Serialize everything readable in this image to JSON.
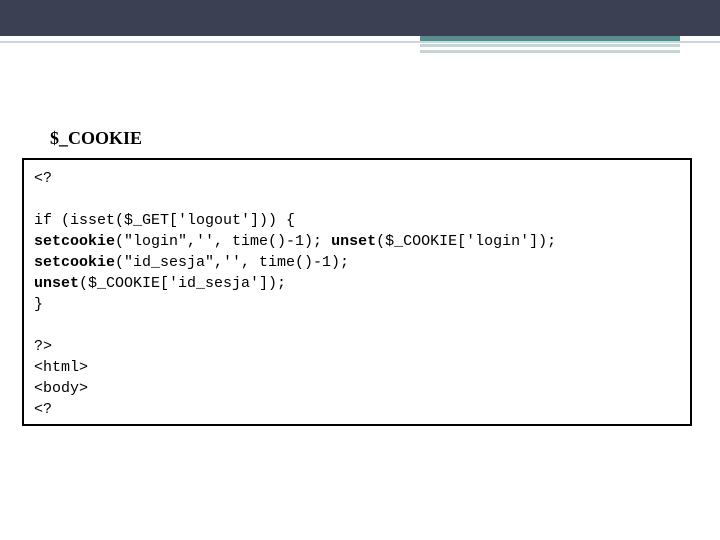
{
  "heading": "$_COOKIE",
  "code": {
    "l1": "<?",
    "l2": "",
    "l3": "if (isset($_GET['logout'])) {",
    "l4a": "setcookie",
    "l4b": "(\"login\",'', time()-1); ",
    "l4c": "unset",
    "l4d": "($_COOKIE['login']);",
    "l5a": "setcookie",
    "l5b": "(\"id_sesja\",'', time()-1);",
    "l6a": "unset",
    "l6b": "($_COOKIE['id_sesja']);",
    "l7": "}",
    "l8": "",
    "l9": "?>",
    "l10": "<html>",
    "l11": "<body>",
    "l12": "<?"
  }
}
